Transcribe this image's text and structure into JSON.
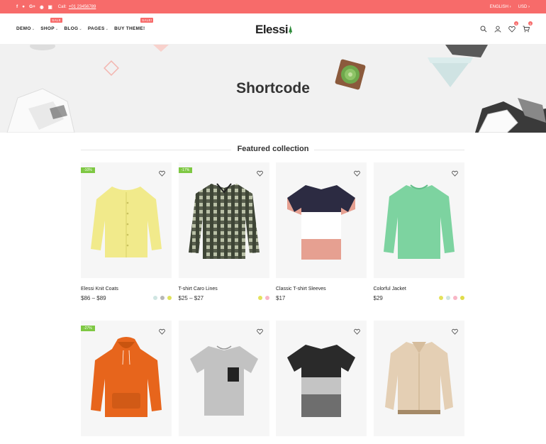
{
  "topbar": {
    "call_label": "Call:",
    "phone": "+01 23456789",
    "language": "ENGLISH",
    "currency": "USD"
  },
  "header": {
    "logo": "Elessi",
    "nav": [
      {
        "label": "DEMO",
        "badge": ""
      },
      {
        "label": "SHOP",
        "badge": "SALE"
      },
      {
        "label": "BLOG",
        "badge": ""
      },
      {
        "label": "PAGES",
        "badge": ""
      },
      {
        "label": "BUY THEME!",
        "badge": "SALE!"
      }
    ],
    "wishlist_count": "0",
    "cart_count": "0"
  },
  "hero": {
    "title": "Shortcode"
  },
  "section": {
    "title": "Featured collection"
  },
  "products": [
    {
      "name": "Elessi Knit Coats",
      "price": "$86 – $89",
      "discount": "-10%",
      "swatches": [
        "#cfe5e2",
        "#b7b7b7",
        "#e0e25c"
      ],
      "garment": "cardigan",
      "color": "#f1ea8b"
    },
    {
      "name": "T-shirt Caro Lines",
      "price": "$25 – $27",
      "discount": "-17%",
      "swatches": [
        "#e4e25c",
        "#f8b6c6"
      ],
      "garment": "plaid",
      "color": "#3e4536"
    },
    {
      "name": "Classic T-shirt Sleeves",
      "price": "$17",
      "discount": "",
      "swatches": [],
      "garment": "tee-block",
      "color": "#2c2b42"
    },
    {
      "name": "Colorful Jacket",
      "price": "$29",
      "discount": "",
      "swatches": [
        "#e4e25c",
        "#cfe5e2",
        "#f8b6c6",
        "#e0dc4a"
      ],
      "garment": "sweater",
      "color": "#7dd3a0"
    },
    {
      "name": "",
      "price": "",
      "discount": "-27%",
      "swatches": [],
      "garment": "hoodie",
      "color": "#e7651c"
    },
    {
      "name": "",
      "price": "",
      "discount": "",
      "swatches": [],
      "garment": "tee-pocket",
      "color": "#c2c2c2"
    },
    {
      "name": "",
      "price": "",
      "discount": "",
      "swatches": [],
      "garment": "tee-stripe",
      "color": "#2a2a2a"
    },
    {
      "name": "",
      "price": "",
      "discount": "",
      "swatches": [],
      "garment": "jacket",
      "color": "#e4cfb4"
    }
  ]
}
